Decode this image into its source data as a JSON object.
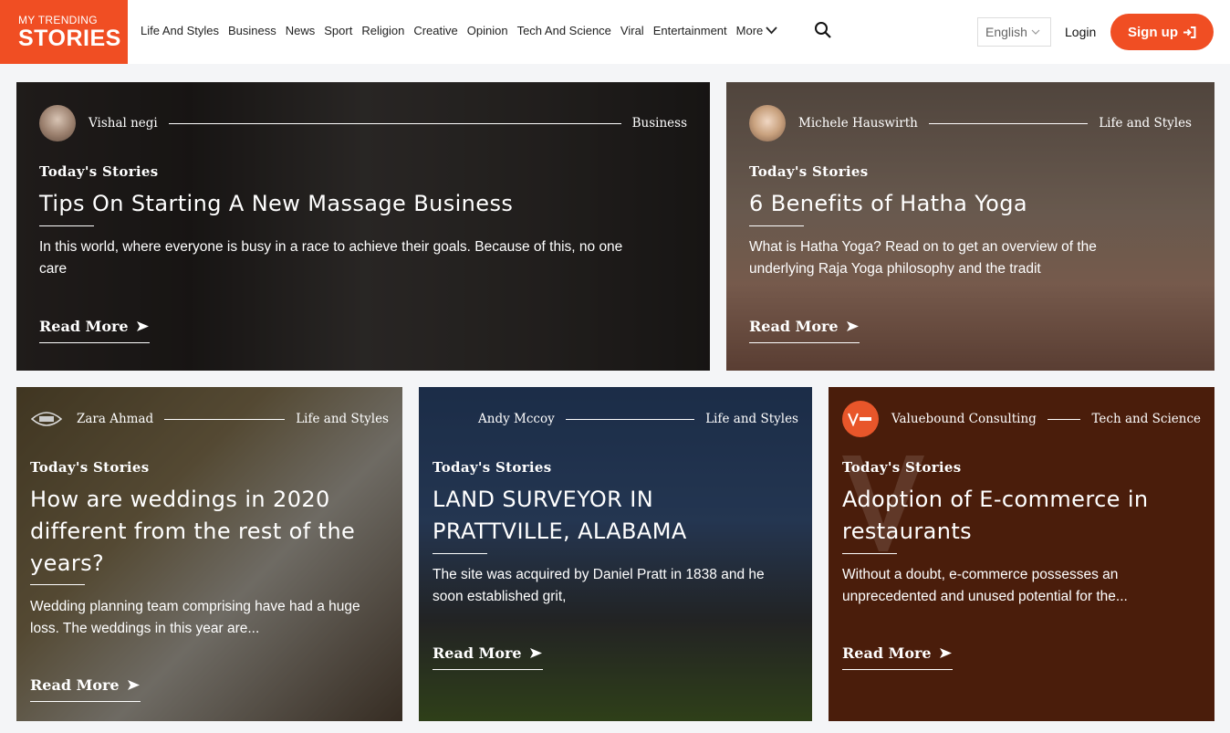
{
  "header": {
    "logo_line1": "MY TRENDING",
    "logo_line2": "STORIES",
    "nav": [
      "Life And Styles",
      "Business",
      "News",
      "Sport",
      "Religion",
      "Creative",
      "Opinion",
      "Tech And Science",
      "Viral",
      "Entertainment"
    ],
    "more_label": "More",
    "language": "English",
    "login_label": "Login",
    "signup_label": "Sign up"
  },
  "section_label": "Today's Stories",
  "read_more": "Read More",
  "cards": [
    {
      "author": "Vishal negi",
      "category": "Business",
      "title": "Tips On Starting A New Massage Business",
      "excerpt": "In this world, where everyone is busy in a race to achieve their goals. Because of this, no one care"
    },
    {
      "author": "Michele Hauswirth",
      "category": "Life and Styles",
      "title": "6 Benefits of Hatha Yoga",
      "excerpt": "What is Hatha Yoga? Read on to get an overview of the underlying Raja Yoga philosophy and the tradit"
    },
    {
      "author": "Zara Ahmad",
      "category": "Life and Styles",
      "title": "How are weddings in 2020 different from the rest of the years?",
      "excerpt": "Wedding planning team comprising have had a huge loss. The weddings in this year are..."
    },
    {
      "author": "Andy Mccoy",
      "category": "Life and Styles",
      "title": "LAND SURVEYOR IN PRATTVILLE, ALABAMA",
      "excerpt": "The site was acquired by Daniel Pratt in 1838 and he soon established grit,"
    },
    {
      "author": "Valuebound Consulting",
      "category": "Tech and Science",
      "title": "Adoption of E-commerce in restaurants",
      "excerpt": "Without a doubt, e-commerce possesses an unprecedented and unused potential for the..."
    }
  ],
  "colors": {
    "brand": "#f04e23"
  }
}
